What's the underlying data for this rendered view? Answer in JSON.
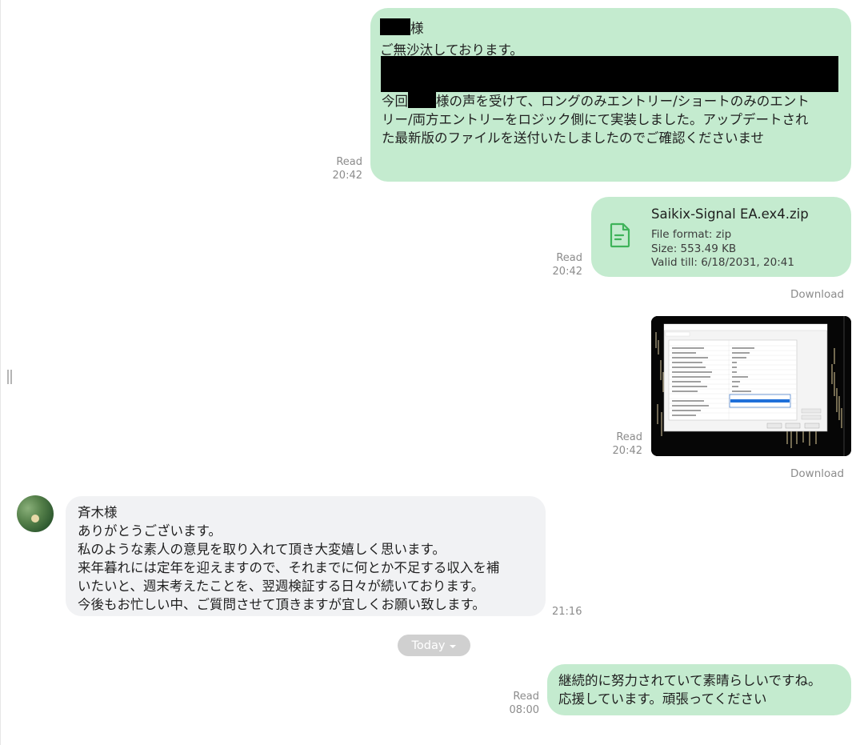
{
  "messages": [
    {
      "id": "m1",
      "direction": "outgoing",
      "lines": {
        "greeting_suffix": "様",
        "line2": "ご無沙汰しております。",
        "para_prefix": "今回",
        "para_rest": "様の声を受けて、ロングのみエントリー/ショートのみのエント\nリー/両方エントリーをロジック側にて実装しました。アップデートされ\nた最新版のファイルを送付いたしましたのでご確認くださいませ"
      },
      "status": "Read",
      "time": "20:42"
    },
    {
      "id": "m2",
      "direction": "outgoing",
      "file": {
        "name": "Saikix-Signal EA.ex4.zip",
        "format": "File format: zip",
        "size": "Size: 553.49 KB",
        "valid": "Valid till: 6/18/2031, 20:41",
        "icon": "document-icon"
      },
      "status": "Read",
      "time": "20:42",
      "download": "Download"
    },
    {
      "id": "m3",
      "direction": "outgoing",
      "image": "EA settings dialog screenshot",
      "status": "Read",
      "time": "20:42",
      "download": "Download"
    },
    {
      "id": "m4",
      "direction": "incoming",
      "text": "斉木様\nありがとうございます。\n私のような素人の意見を取り入れて頂き大変嬉しく思います。\n来年暮れには定年を迎えますので、それまでに何とか不足する収入を補\nいたいと、週末考えたことを、翌週検証する日々が続いております。\n今後もお忙しい中、ご質問させて頂きますが宜しくお願い致します。",
      "time": "21:16"
    },
    {
      "id": "m5",
      "direction": "outgoing",
      "text": "継続的に努力されていて素晴らしいですね。\n応援しています。頑張ってください",
      "status": "Read",
      "time": "08:00"
    }
  ],
  "day_separator": "Today",
  "colors": {
    "outgoing_bubble": "#c4ebcf",
    "incoming_bubble": "#f1f2f4",
    "meta_text": "#8c8c8c",
    "file_icon": "#3fb35a",
    "day_chip": "#d0d0d0"
  }
}
